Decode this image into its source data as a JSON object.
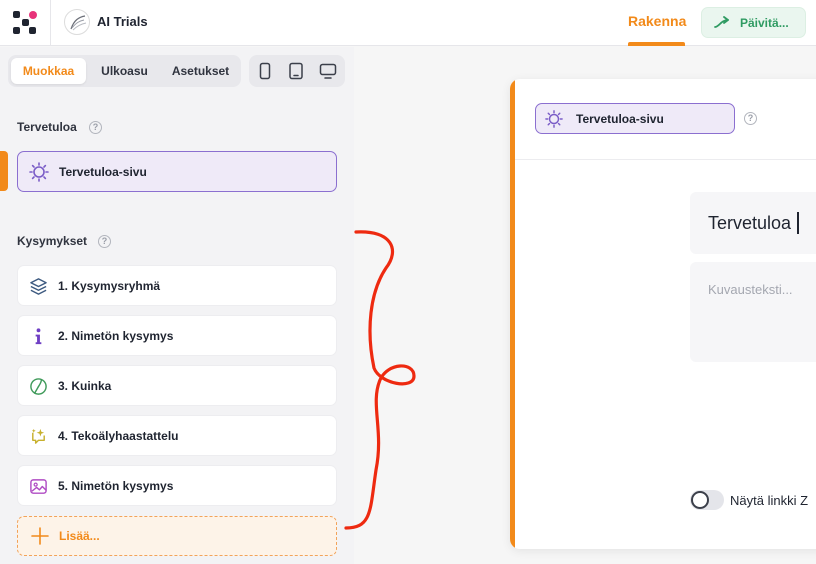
{
  "header": {
    "project_name": "AI Trials",
    "build_tab": "Rakenna",
    "update_button": "Päivitä...",
    "accent_color": "#f28a1a"
  },
  "sidebar": {
    "tabs": [
      "Muokkaa",
      "Ulkoasu",
      "Asetukset"
    ],
    "active_tab": "Muokkaa",
    "device_icons": [
      "mobile-icon",
      "tablet-icon",
      "desktop-icon"
    ],
    "welcome_section": {
      "label": "Tervetuloa",
      "help": "?",
      "item": "Tervetuloa-sivu"
    },
    "questions_section": {
      "label": "Kysymykset",
      "help": "?",
      "items": [
        {
          "label": "1. Kysymysryhmä",
          "icon": "layers-icon"
        },
        {
          "label": "2. Nimetön kysymys",
          "icon": "info-icon"
        },
        {
          "label": "3. Kuinka",
          "icon": "gauge-icon"
        },
        {
          "label": "4. Tekoälyhaastattelu",
          "icon": "ai-chat-icon"
        },
        {
          "label": "5. Nimetön kysymys",
          "icon": "image-icon"
        }
      ]
    },
    "add_button": "Lisää..."
  },
  "preview": {
    "page_pill": "Tervetuloa-sivu",
    "help": "?",
    "title_value": "Tervetuloa",
    "description_placeholder": "Kuvausteksti...",
    "toggle_label": "Näytä linkki Z"
  }
}
